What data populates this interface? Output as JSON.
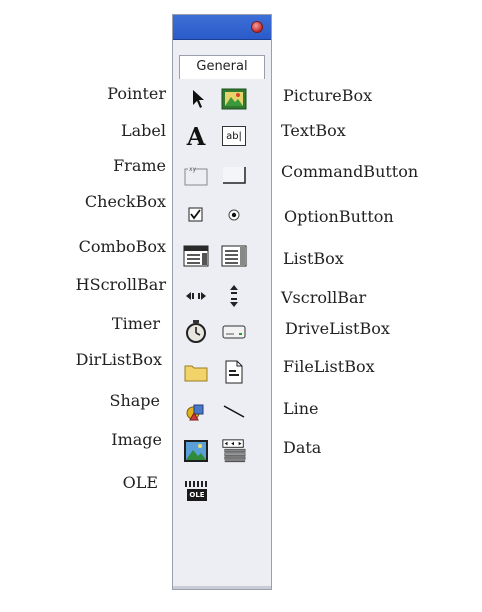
{
  "toolbox": {
    "tab_label": "General"
  },
  "left_labels": {
    "pointer": "Pointer",
    "label": "Label",
    "frame": "Frame",
    "checkbox": "CheckBox",
    "combobox": "ComboBox",
    "hscrollbar": "HScrollBar",
    "timer": "Timer",
    "dirlistbox": "DirListBox",
    "shape": "Shape",
    "image": "Image",
    "ole": "OLE"
  },
  "right_labels": {
    "picturebox": "PictureBox",
    "textbox": "TextBox",
    "commandbutton": "CommandButton",
    "optionbutton": "OptionButton",
    "listbox": "ListBox",
    "vscrollbar": "VscrollBar",
    "drivelistbox": "DriveListBox",
    "filelistbox": "FileListBox",
    "line": "Line",
    "data": "Data"
  },
  "icons": {
    "label_glyph": "A",
    "textbox_glyph": "ab|",
    "ole_glyph": "OLE"
  }
}
